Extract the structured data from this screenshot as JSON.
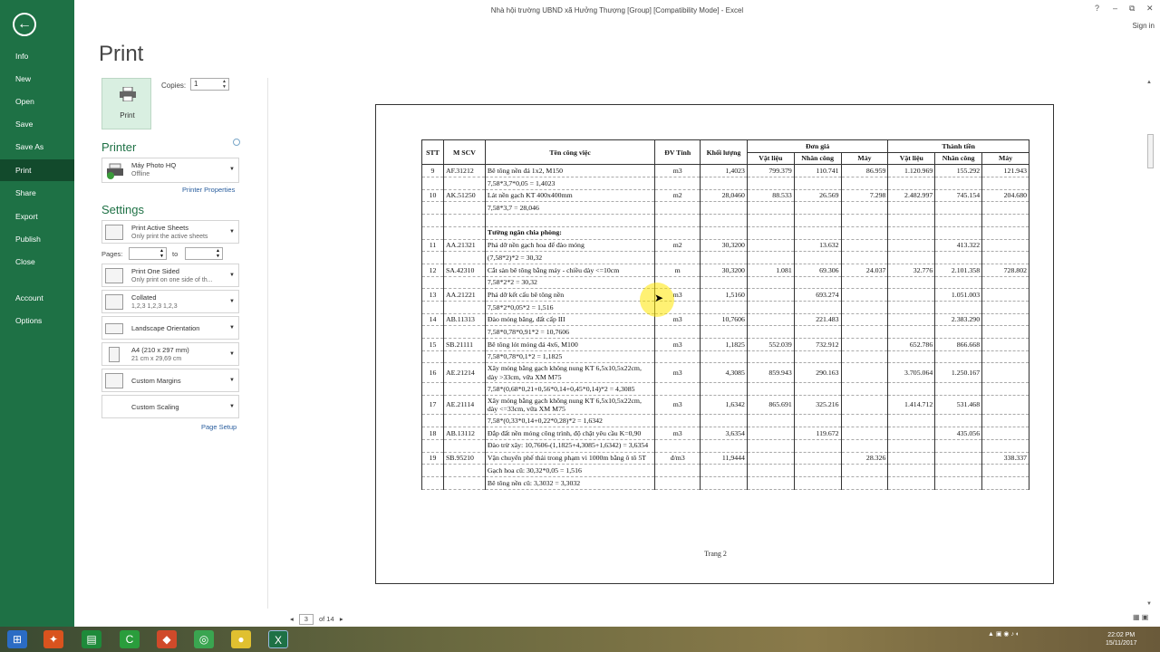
{
  "window": {
    "title": "Nhà hội trường UBND xã Hưởng Thượng [Group] [Compatibility Mode] - Excel",
    "controls": [
      "?",
      "–",
      "⧉",
      "✕"
    ],
    "signin": "Sign in"
  },
  "nav": {
    "items": [
      "Info",
      "New",
      "Open",
      "Save",
      "Save As",
      "Print",
      "Share",
      "Export",
      "Publish",
      "Close",
      "Account",
      "Options"
    ],
    "active": "Print"
  },
  "print": {
    "heading": "Print",
    "button_label": "Print",
    "copies_label": "Copies:",
    "copies_value": "1",
    "printer_heading": "Printer",
    "printer_name": "Máy Photo HQ",
    "printer_status": "Offline",
    "printer_properties": "Printer Properties",
    "settings_heading": "Settings",
    "print_what": "Print Active Sheets",
    "print_what_desc": "Only print the active sheets",
    "pages_label": "Pages:",
    "to_label": "to",
    "sided": "Print One Sided",
    "sided_desc": "Only print on one side of th...",
    "collated": "Collated",
    "collated_desc": "1,2,3    1,2,3    1,2,3",
    "orientation": "Landscape Orientation",
    "paper": "A4 (210 x 297 mm)",
    "paper_desc": "21 cm x 29,69 cm",
    "margins": "Custom Margins",
    "scaling": "Custom Scaling",
    "page_setup": "Page Setup"
  },
  "preview": {
    "headers": {
      "stt": "STT",
      "mscv": "M SCV",
      "ten": "Tên công việc",
      "dvt": "ĐV Tính",
      "kl": "Khối lượng",
      "dongia": "Đơn giá",
      "thanhtien": "Thành tiền",
      "vl": "Vật liệu",
      "nc": "Nhân công",
      "may": "Máy"
    },
    "rows": [
      {
        "stt": "9",
        "ma": "AF.31212",
        "ten": "Bê tông nền đá 1x2, M150",
        "dvt": "m3",
        "kl": "1,4023",
        "vl": "799.379",
        "nc": "110.741",
        "may": "86.959",
        "tvl": "1.120.969",
        "tnc": "155.292",
        "tmay": "121.943"
      },
      {
        "stt": "",
        "ma": "",
        "ten": "7,58*3,7*0,05 = 1,4023",
        "dvt": "",
        "kl": "",
        "vl": "",
        "nc": "",
        "may": "",
        "tvl": "",
        "tnc": "",
        "tmay": ""
      },
      {
        "stt": "10",
        "ma": "AK.51250",
        "ten": "Lát nền gạch KT 400x400mm",
        "dvt": "m2",
        "kl": "28,0460",
        "vl": "88.533",
        "nc": "26.569",
        "may": "7.298",
        "tvl": "2.482.997",
        "tnc": "745.154",
        "tmay": "204.680"
      },
      {
        "stt": "",
        "ma": "",
        "ten": "7,58*3,7 = 28,046",
        "dvt": "",
        "kl": "",
        "vl": "",
        "nc": "",
        "may": "",
        "tvl": "",
        "tnc": "",
        "tmay": ""
      },
      {
        "stt": "",
        "ma": "",
        "ten": "",
        "dvt": "",
        "kl": "",
        "vl": "",
        "nc": "",
        "may": "",
        "tvl": "",
        "tnc": "",
        "tmay": ""
      },
      {
        "stt": "",
        "ma": "",
        "ten": "Tường ngăn chia phòng:",
        "dvt": "",
        "kl": "",
        "vl": "",
        "nc": "",
        "may": "",
        "tvl": "",
        "tnc": "",
        "tmay": "",
        "bold": true
      },
      {
        "stt": "11",
        "ma": "AA.21321",
        "ten": "Phá dỡ nền gạch hoa để đào móng",
        "dvt": "m2",
        "kl": "30,3200",
        "vl": "",
        "nc": "13.632",
        "may": "",
        "tvl": "",
        "tnc": "413.322",
        "tmay": ""
      },
      {
        "stt": "",
        "ma": "",
        "ten": "(7,58*2)*2 = 30,32",
        "dvt": "",
        "kl": "",
        "vl": "",
        "nc": "",
        "may": "",
        "tvl": "",
        "tnc": "",
        "tmay": ""
      },
      {
        "stt": "12",
        "ma": "SA.42310",
        "ten": "Cắt sàn bê tông bằng máy - chiều dày <=10cm",
        "dvt": "m",
        "kl": "30,3200",
        "vl": "1.081",
        "nc": "69.306",
        "may": "24.037",
        "tvl": "32.776",
        "tnc": "2.101.358",
        "tmay": "728.802"
      },
      {
        "stt": "",
        "ma": "",
        "ten": "7,58*2*2 = 30,32",
        "dvt": "",
        "kl": "",
        "vl": "",
        "nc": "",
        "may": "",
        "tvl": "",
        "tnc": "",
        "tmay": ""
      },
      {
        "stt": "13",
        "ma": "AA.21221",
        "ten": "Phá dỡ kết cấu bê tông nền",
        "dvt": "m3",
        "kl": "1,5160",
        "vl": "",
        "nc": "693.274",
        "may": "",
        "tvl": "",
        "tnc": "1.051.003",
        "tmay": ""
      },
      {
        "stt": "",
        "ma": "",
        "ten": "7,58*2*0,05*2 = 1,516",
        "dvt": "",
        "kl": "",
        "vl": "",
        "nc": "",
        "may": "",
        "tvl": "",
        "tnc": "",
        "tmay": ""
      },
      {
        "stt": "14",
        "ma": "AB.11313",
        "ten": "Đào móng băng, đất cấp III",
        "dvt": "m3",
        "kl": "10,7606",
        "vl": "",
        "nc": "221.483",
        "may": "",
        "tvl": "",
        "tnc": "2.383.290",
        "tmay": ""
      },
      {
        "stt": "",
        "ma": "",
        "ten": "7,58*0,78*0,91*2 = 10,7606",
        "dvt": "",
        "kl": "",
        "vl": "",
        "nc": "",
        "may": "",
        "tvl": "",
        "tnc": "",
        "tmay": ""
      },
      {
        "stt": "15",
        "ma": "SB.21111",
        "ten": "Bê tông lót móng đá 4x6, M100",
        "dvt": "m3",
        "kl": "1,1825",
        "vl": "552.039",
        "nc": "732.912",
        "may": "",
        "tvl": "652.786",
        "tnc": "866.668",
        "tmay": ""
      },
      {
        "stt": "",
        "ma": "",
        "ten": "7,58*0,78*0,1*2 = 1,1825",
        "dvt": "",
        "kl": "",
        "vl": "",
        "nc": "",
        "may": "",
        "tvl": "",
        "tnc": "",
        "tmay": ""
      },
      {
        "stt": "16",
        "ma": "AE.21214",
        "ten": "Xây móng bằng gạch không nung KT 6,5x10,5x22cm, dày >33cm, vữa XM M75",
        "dvt": "m3",
        "kl": "4,3085",
        "vl": "859.943",
        "nc": "290.163",
        "may": "",
        "tvl": "3.705.064",
        "tnc": "1.250.167",
        "tmay": ""
      },
      {
        "stt": "",
        "ma": "",
        "ten": "7,58*(0,68*0,21+0,56*0,14+0,45*0,14)*2 = 4,3085",
        "dvt": "",
        "kl": "",
        "vl": "",
        "nc": "",
        "may": "",
        "tvl": "",
        "tnc": "",
        "tmay": ""
      },
      {
        "stt": "17",
        "ma": "AE.21114",
        "ten": "Xây móng bằng gạch không nung KT 6,5x10,5x22cm, dày <=33cm, vữa XM M75",
        "dvt": "m3",
        "kl": "1,6342",
        "vl": "865.691",
        "nc": "325.216",
        "may": "",
        "tvl": "1.414.712",
        "tnc": "531.468",
        "tmay": ""
      },
      {
        "stt": "",
        "ma": "",
        "ten": "7,58*(0,33*0,14+0,22*0,28)*2 = 1,6342",
        "dvt": "",
        "kl": "",
        "vl": "",
        "nc": "",
        "may": "",
        "tvl": "",
        "tnc": "",
        "tmay": ""
      },
      {
        "stt": "18",
        "ma": "AB.13112",
        "ten": "Đắp đất nền móng công trình, độ chặt yêu cầu K=0,90",
        "dvt": "m3",
        "kl": "3,6354",
        "vl": "",
        "nc": "119.672",
        "may": "",
        "tvl": "",
        "tnc": "435.056",
        "tmay": ""
      },
      {
        "stt": "",
        "ma": "",
        "ten": "Đào trừ xây: 10,7606-(1,1825+4,3085+1,6342) = 3,6354",
        "dvt": "",
        "kl": "",
        "vl": "",
        "nc": "",
        "may": "",
        "tvl": "",
        "tnc": "",
        "tmay": ""
      },
      {
        "stt": "19",
        "ma": "SB.95210",
        "ten": "Vận chuyển phế thải trong phạm vi 1000m bằng ô tô 5T",
        "dvt": "đ/m3",
        "kl": "11,9444",
        "vl": "",
        "nc": "",
        "may": "28.326",
        "tvl": "",
        "tnc": "",
        "tmay": "338.337"
      },
      {
        "stt": "",
        "ma": "",
        "ten": "Gạch hoa cũ: 30,32*0,05 = 1,516",
        "dvt": "",
        "kl": "",
        "vl": "",
        "nc": "",
        "may": "",
        "tvl": "",
        "tnc": "",
        "tmay": ""
      },
      {
        "stt": "",
        "ma": "",
        "ten": "Bê tông nền cũ: 3,3032 = 3,3032",
        "dvt": "",
        "kl": "",
        "vl": "",
        "nc": "",
        "may": "",
        "tvl": "",
        "tnc": "",
        "tmay": ""
      }
    ],
    "footer": "Trang 2",
    "current_page": "3",
    "page_total": "of 14"
  },
  "taskbar": {
    "time": "22:02 PM",
    "date": "15/11/2017"
  },
  "colors": {
    "nav_bg": "#1e7145",
    "nav_active": "#124a2c",
    "accent": "#1e7145",
    "link": "#2a5e9e"
  }
}
